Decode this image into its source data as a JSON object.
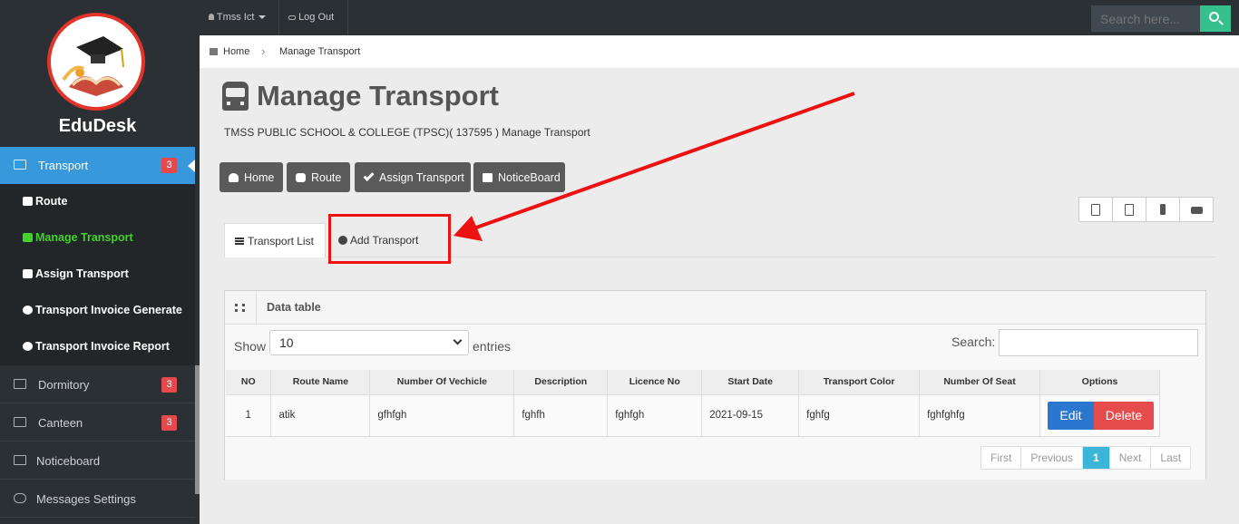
{
  "brand": {
    "name": "EduDesk"
  },
  "topbar": {
    "user_label": "Tmss Ict",
    "logout_label": "Log Out",
    "search_placeholder": "Search here..."
  },
  "breadcrumb": {
    "home": "Home",
    "current": "Manage Transport"
  },
  "sidebar": {
    "transport": {
      "label": "Transport",
      "badge": "3"
    },
    "sub_items": [
      {
        "label": "Route"
      },
      {
        "label": "Manage Transport"
      },
      {
        "label": "Assign Transport"
      },
      {
        "label": "Transport Invoice Generate"
      },
      {
        "label": "Transport Invoice Report"
      }
    ],
    "dormitory": {
      "label": "Dormitory",
      "badge": "3"
    },
    "canteen": {
      "label": "Canteen",
      "badge": "3"
    },
    "noticeboard": {
      "label": "Noticeboard"
    },
    "messages": {
      "label": "Messages Settings"
    }
  },
  "page": {
    "title": "Manage Transport",
    "subtitle": "TMSS PUBLIC SCHOOL & COLLEGE (TPSC)( 137595 ) Manage Transport"
  },
  "actions": {
    "home": "Home",
    "route": "Route",
    "assign": "Assign Transport",
    "noticeboard": "NoticeBoard"
  },
  "export": {
    "icons": [
      "pdf-icon",
      "excel-icon",
      "download-icon",
      "print-icon"
    ]
  },
  "tabs": {
    "list": "Transport List",
    "add": "Add Transport"
  },
  "datatable": {
    "title": "Data table",
    "show_label": "Show",
    "page_length": "10",
    "entries_label": "entries",
    "search_label": "Search:",
    "columns": [
      "NO",
      "Route Name",
      "Number Of Vechicle",
      "Description",
      "Licence No",
      "Start Date",
      "Transport Color",
      "Number Of Seat",
      "Options"
    ],
    "rows": [
      {
        "no": "1",
        "route": "atik",
        "vehicle": "gfhfgh",
        "description": "fghfh",
        "licence": "fghfgh",
        "start": "2021-09-15",
        "color": "fghfg",
        "seat": "fghfghfg"
      }
    ],
    "edit_label": "Edit",
    "delete_label": "Delete",
    "pager": {
      "first": "First",
      "previous": "Previous",
      "current": "1",
      "next": "Next",
      "last": "Last"
    }
  },
  "colors": {
    "sidebar": "#2b3035",
    "active": "#3799db",
    "badge": "#e5484d",
    "highlight": "#ee1111",
    "green_active": "#43d12b"
  }
}
